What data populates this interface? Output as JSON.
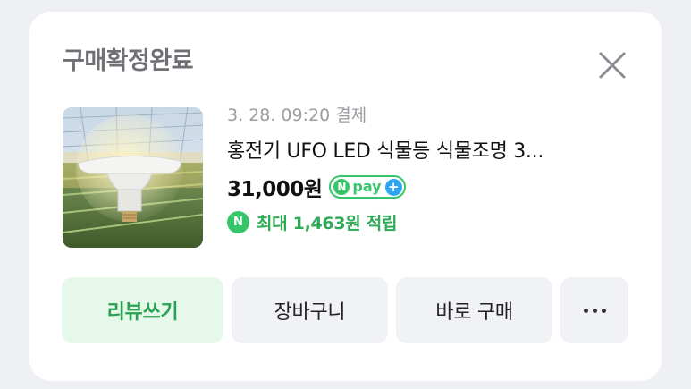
{
  "order": {
    "status": "구매확정완료",
    "date": "3. 28. 09:20 결제",
    "product_title": "홍전기 UFO LED 식물등 식물조명 3...",
    "price": "31,000원",
    "npay": {
      "n_letter": "N",
      "label": "pay",
      "plus": "+"
    },
    "points": {
      "icon_letter": "N",
      "text": "최대 1,463원 적립"
    }
  },
  "actions": {
    "review": "리뷰쓰기",
    "cart": "장바구니",
    "buy_now": "바로 구매"
  },
  "colors": {
    "accent_green": "#2aa052",
    "review_bg": "#e5f8ea",
    "npay_green": "#37c56a",
    "plus_blue": "#2ea3f2",
    "page_bg": "#eef0f3"
  },
  "icons": {
    "close": "close-icon",
    "more": "more-horizontal-icon",
    "npay": "npay-icon",
    "points": "naver-point-icon"
  }
}
